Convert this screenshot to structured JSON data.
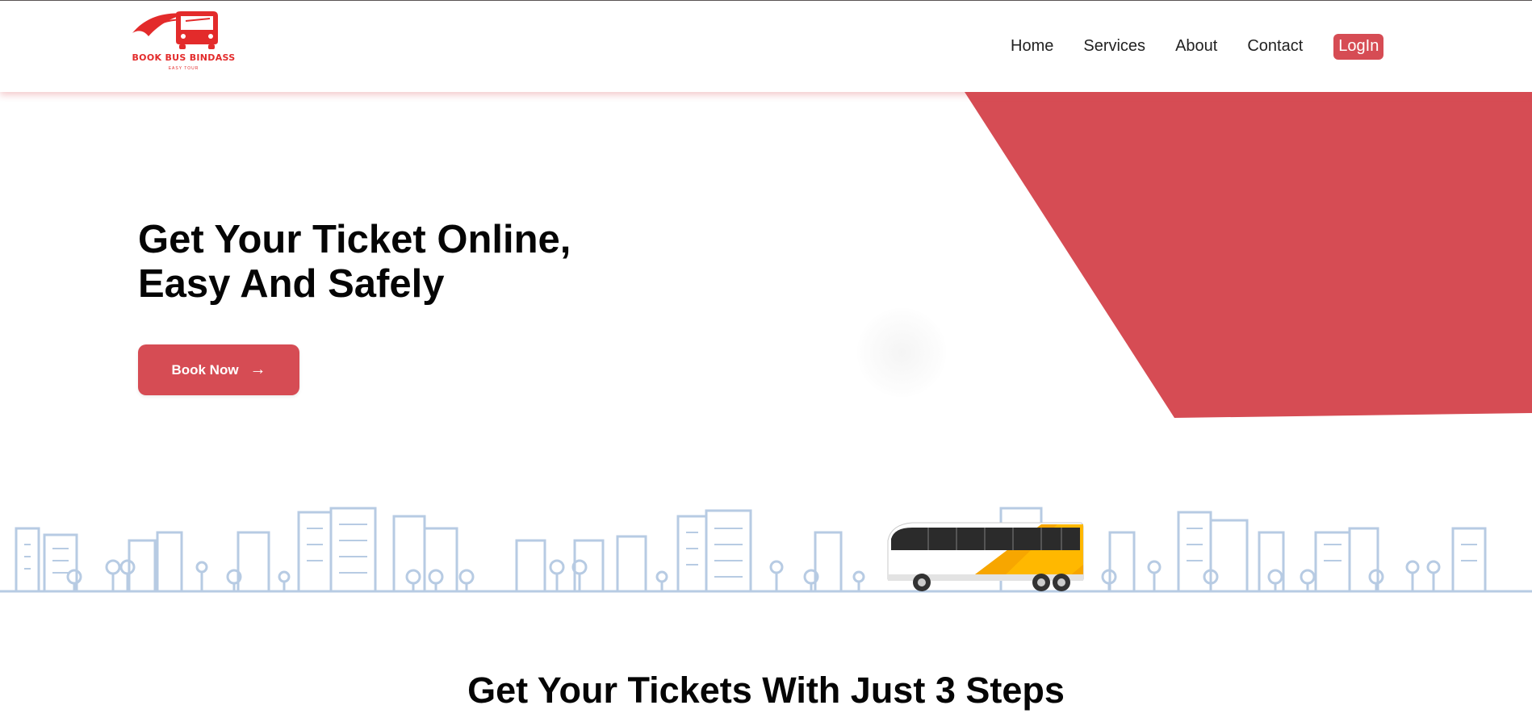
{
  "brand": {
    "name": "BOOK BUS BINDASS",
    "tagline": "EASY TOUR",
    "color": "#e32b2b"
  },
  "nav": {
    "items": [
      "Home",
      "Services",
      "About",
      "Contact"
    ],
    "login_label": "LogIn",
    "accent": "#d64c54"
  },
  "hero": {
    "title_line1": "Get Your Ticket Online,",
    "title_line2": "Easy And Safely",
    "cta_label": "Book Now",
    "cta_icon": "arrow-right-icon",
    "shape_color": "#d64c54"
  },
  "illustration": {
    "skyline_color": "#b7cbe3",
    "bus_colors": [
      "#f7a600",
      "#2b2b2b",
      "#ffffff"
    ]
  },
  "steps": {
    "title": "Get Your Tickets With Just 3 Steps"
  }
}
